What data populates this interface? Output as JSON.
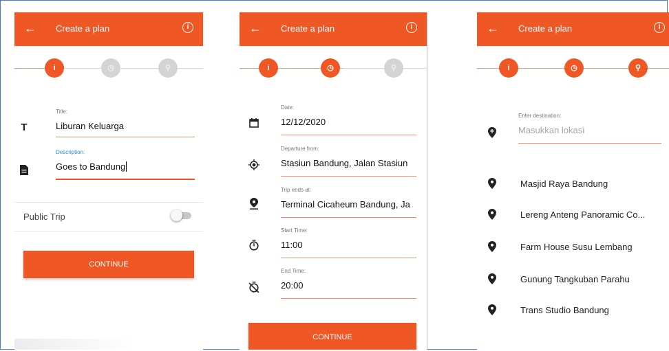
{
  "colors": {
    "accent": "#ef5724",
    "frame": "#4a7bbf"
  },
  "screen1": {
    "appbar": {
      "back_icon": "arrow-left-icon",
      "title": "Create a plan",
      "info_icon": "info-icon"
    },
    "steps": [
      "i",
      "◷",
      "⚲"
    ],
    "title_field": {
      "label": "Title:",
      "value": "Liburan Keluarga",
      "icon": "text-icon"
    },
    "description_field": {
      "label": "Description:",
      "value_prefix": "Goes to ",
      "value_misspelled": "Bandung",
      "icon": "document-icon"
    },
    "public_trip": {
      "label": "Public Trip",
      "enabled": false
    },
    "continue_label": "CONTINUE"
  },
  "screen2": {
    "appbar": {
      "back_icon": "arrow-left-icon",
      "title": "Create a plan",
      "info_icon": "info-icon"
    },
    "steps": [
      "i",
      "◷",
      "⚲"
    ],
    "fields": [
      {
        "label": "Date:",
        "value": "12/12/2020",
        "icon": "calendar-icon"
      },
      {
        "label": "Departure from:",
        "value": "Stasiun Bandung, Jalan Stasiun",
        "icon": "gps-icon"
      },
      {
        "label": "Trip ends at:",
        "value": "Terminal Cicaheum Bandung, Ja",
        "icon": "place-icon"
      },
      {
        "label": "Start Time:",
        "value": "11:00",
        "icon": "timer-icon"
      },
      {
        "label": "End Time:",
        "value": "20:00",
        "icon": "timer-off-icon"
      }
    ],
    "continue_label": "CONTINUE"
  },
  "screen3": {
    "appbar": {
      "back_icon": "arrow-left-icon",
      "title": "Create a plan",
      "info_icon": "info-icon"
    },
    "steps": [
      "i",
      "◷",
      "⚲"
    ],
    "destination": {
      "label": "Enter destination:",
      "placeholder": "Masukkan lokasi",
      "icon": "add-location-icon"
    },
    "places": [
      "Masjid Raya Bandung",
      "Lereng Anteng Panoramic Co...",
      "Farm House Susu Lembang",
      "Gunung Tangkuban Parahu",
      "Trans Studio Bandung"
    ]
  }
}
